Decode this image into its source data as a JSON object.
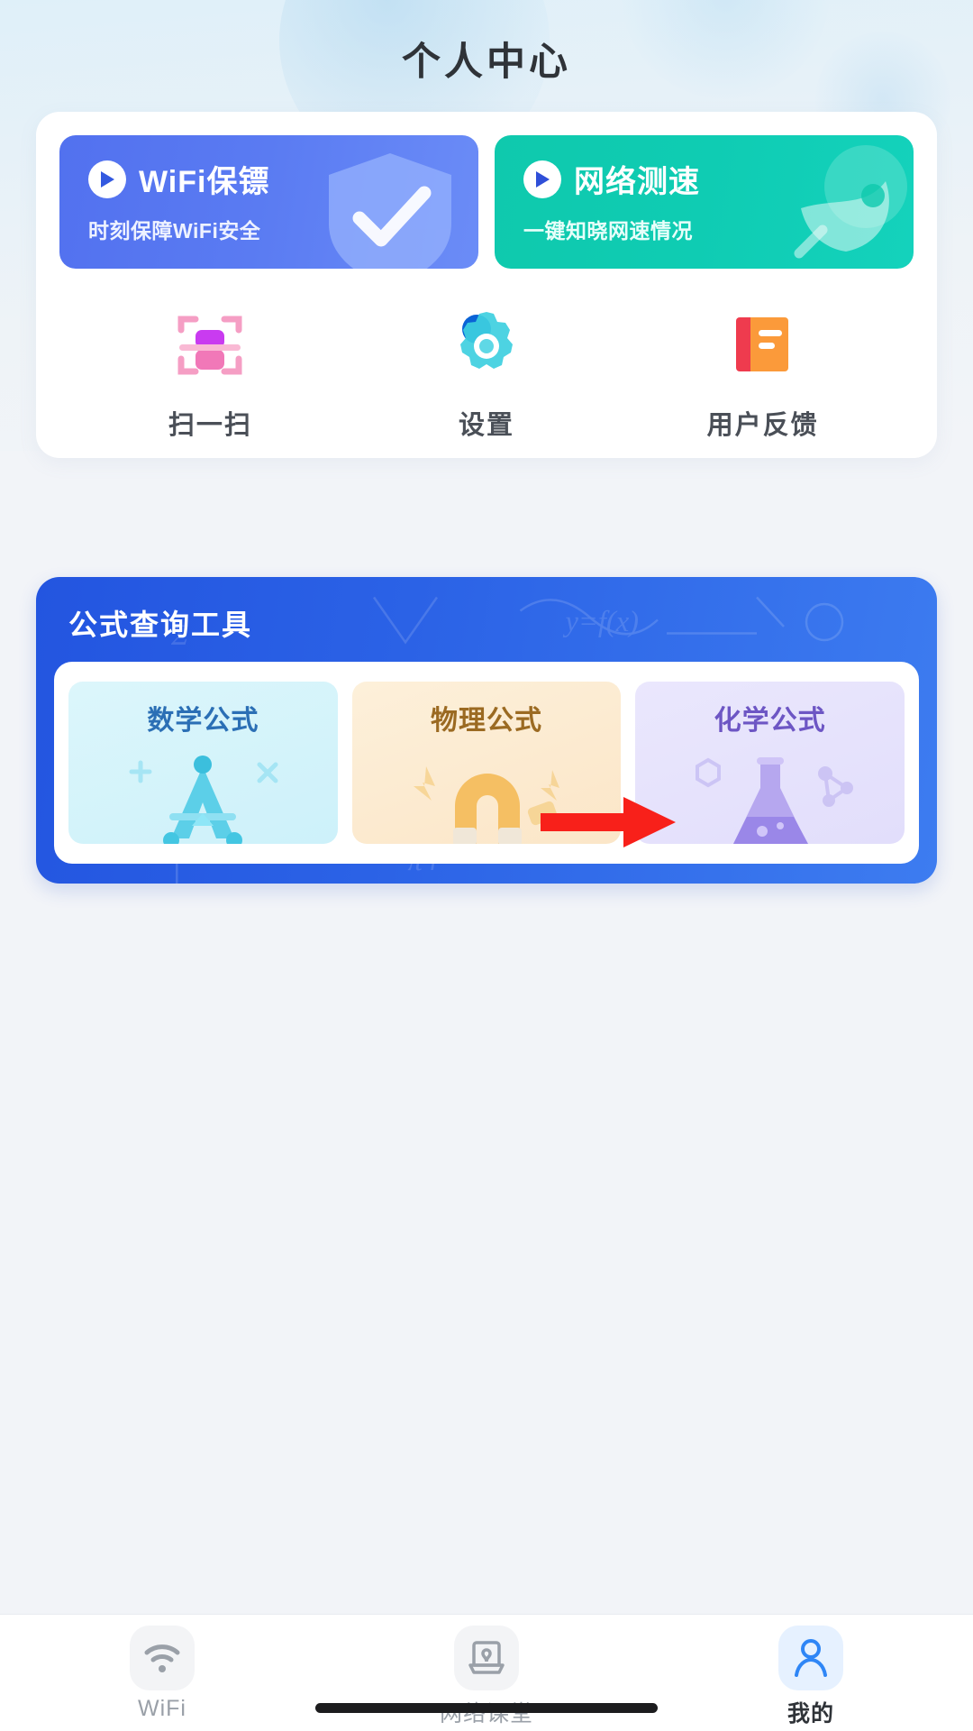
{
  "header": {
    "title": "个人中心"
  },
  "banners": [
    {
      "id": "wifi-guard",
      "title": "WiFi保镖",
      "subtitle": "时刻保障WiFi安全",
      "color": "#5271ef",
      "icon": "play-icon",
      "art": "shield-check-icon"
    },
    {
      "id": "speed-test",
      "title": "网络测速",
      "subtitle": "一键知晓网速情况",
      "color": "#0fc9ad",
      "icon": "play-icon",
      "art": "rocket-icon"
    }
  ],
  "quick_actions": [
    {
      "id": "scan",
      "label": "扫一扫",
      "icon": "scan-qr-icon",
      "color": "#e8589c"
    },
    {
      "id": "settings",
      "label": "设置",
      "icon": "gear-icon",
      "color": "#2fb3e0"
    },
    {
      "id": "feedback",
      "label": "用户反馈",
      "icon": "feedback-icon",
      "color": "#f4623a"
    }
  ],
  "formula_section": {
    "title": "公式查询工具",
    "accent": "#2355e0",
    "tiles": [
      {
        "id": "math",
        "label": "数学公式",
        "text_color": "#2b6fb5",
        "bg": "#dcf6fb",
        "art": "compass-icon"
      },
      {
        "id": "physics",
        "label": "物理公式",
        "text_color": "#9b6a22",
        "bg": "#fdf0da",
        "art": "magnet-icon"
      },
      {
        "id": "chemistry",
        "label": "化学公式",
        "text_color": "#6d56c4",
        "bg": "#eae7fd",
        "art": "flask-icon"
      }
    ]
  },
  "annotation": {
    "type": "red-arrow",
    "direction": "right",
    "color": "#f8201a"
  },
  "tabbar": {
    "items": [
      {
        "id": "wifi",
        "label": "WiFi",
        "icon": "wifi-icon",
        "active": false
      },
      {
        "id": "classes",
        "label": "网络课堂",
        "icon": "classroom-icon",
        "active": false
      },
      {
        "id": "mine",
        "label": "我的",
        "icon": "user-icon",
        "active": true
      }
    ],
    "active_color": "#2f86f6"
  }
}
